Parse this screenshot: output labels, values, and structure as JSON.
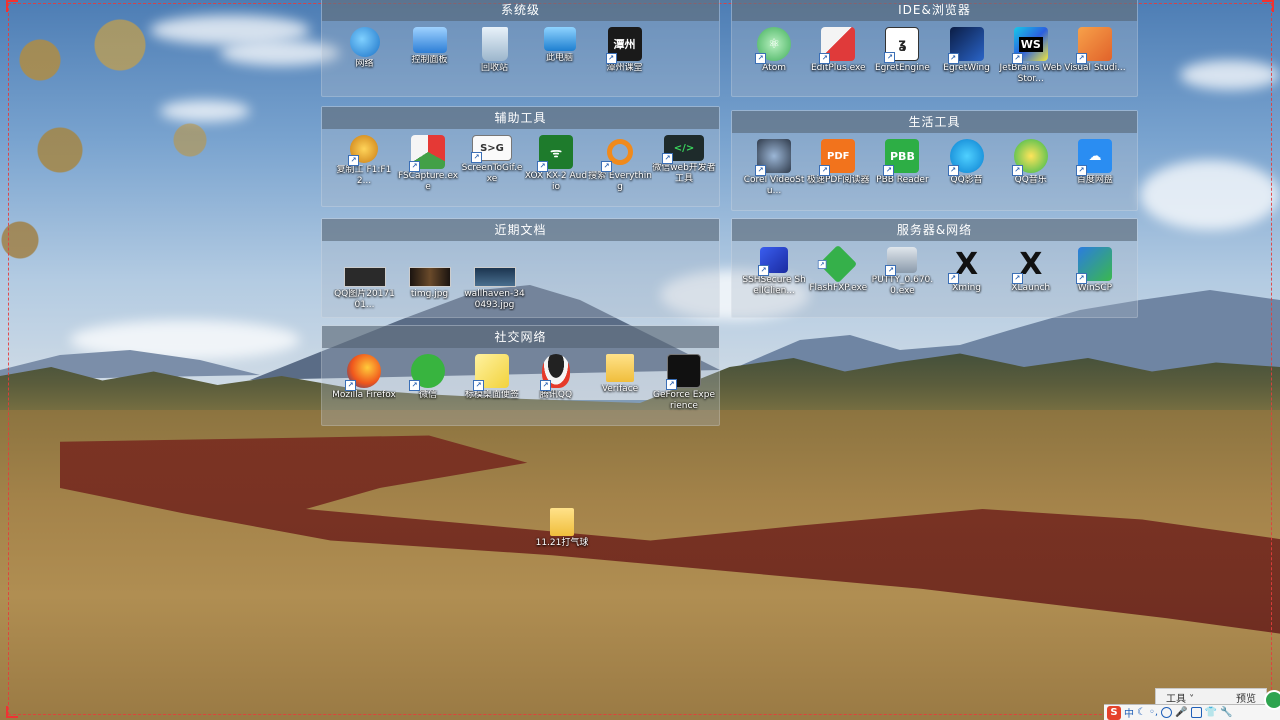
{
  "fences": [
    {
      "id": "system",
      "title": "系统级",
      "icons": [
        {
          "label": "网络",
          "icon": "network-icon",
          "shortcut": false
        },
        {
          "label": "控制面板",
          "icon": "control-panel-icon",
          "shortcut": false
        },
        {
          "label": "回收站",
          "icon": "recycle-bin-icon",
          "shortcut": false
        },
        {
          "label": "此电脑",
          "icon": "this-pc-icon",
          "shortcut": false
        },
        {
          "label": "潭州课堂",
          "icon": "tanzhou-classroom-icon",
          "shortcut": true,
          "glyph_text": "潭州"
        }
      ]
    },
    {
      "id": "ide",
      "title": "IDE&浏览器",
      "icons": [
        {
          "label": "Atom",
          "icon": "atom-icon",
          "shortcut": true
        },
        {
          "label": "EditPlus.exe",
          "icon": "editplus-icon",
          "shortcut": true
        },
        {
          "label": "EgretEngine",
          "icon": "egret-engine-icon",
          "shortcut": true
        },
        {
          "label": "EgretWing",
          "icon": "egret-wing-icon",
          "shortcut": true
        },
        {
          "label": "JetBrains WebStor...",
          "icon": "webstorm-icon",
          "shortcut": true,
          "glyph_text": "WS"
        },
        {
          "label": "Visual Studi...",
          "icon": "visual-studio-code-icon",
          "shortcut": true
        }
      ]
    },
    {
      "id": "aux",
      "title": "辅助工具",
      "icons": [
        {
          "label": "复制工 F1:F12...",
          "icon": "copy-tool-icon",
          "shortcut": true
        },
        {
          "label": "FSCapture.exe",
          "icon": "fscapture-icon",
          "shortcut": true
        },
        {
          "label": "ScreenToGif.exe",
          "icon": "screentogif-icon",
          "shortcut": true,
          "glyph_text": "S>G"
        },
        {
          "label": "XOX KX-2 Audio",
          "icon": "xox-audio-icon",
          "shortcut": true
        },
        {
          "label": "搜索 Everything",
          "icon": "everything-search-icon",
          "shortcut": true
        },
        {
          "label": "微信web开发者工具",
          "icon": "wechat-devtools-icon",
          "shortcut": true,
          "glyph_text": "</>"
        }
      ]
    },
    {
      "id": "life",
      "title": "生活工具",
      "icons": [
        {
          "label": "Corel VideoStu...",
          "icon": "corel-videostudio-icon",
          "shortcut": true
        },
        {
          "label": "极速PDF阅读器",
          "icon": "pdf-reader-icon",
          "shortcut": true,
          "glyph_text": "PDF"
        },
        {
          "label": "PBB Reader",
          "icon": "pbb-reader-icon",
          "shortcut": true,
          "glyph_text": "PBB"
        },
        {
          "label": "QQ影音",
          "icon": "qq-player-icon",
          "shortcut": true
        },
        {
          "label": "QQ音乐",
          "icon": "qq-music-icon",
          "shortcut": true
        },
        {
          "label": "百度网盘",
          "icon": "baidu-netdisk-icon",
          "shortcut": true
        }
      ]
    },
    {
      "id": "docs",
      "title": "近期文档",
      "icons": [
        {
          "label": "QQ图片2017101...",
          "icon": "image-thumbnail-icon",
          "thumb": "#2a2a2a"
        },
        {
          "label": "timg.jpg",
          "icon": "image-thumbnail-icon",
          "thumb": "#4a3a2a"
        },
        {
          "label": "wallhaven-340493.jpg",
          "icon": "image-thumbnail-icon",
          "thumb": "#2c4a66"
        }
      ]
    },
    {
      "id": "server",
      "title": "服务器&网络",
      "icons": [
        {
          "label": "SSHSecure ShellClien...",
          "icon": "ssh-secure-shell-icon",
          "shortcut": true
        },
        {
          "label": "FlashFXP.exe",
          "icon": "flashfxp-icon",
          "shortcut": true
        },
        {
          "label": "PUTTY_0.670.0.exe",
          "icon": "putty-icon",
          "shortcut": true
        },
        {
          "label": "Xming",
          "icon": "xming-icon",
          "shortcut": true,
          "glyph_text": "X"
        },
        {
          "label": "XLaunch",
          "icon": "xlaunch-icon",
          "shortcut": true,
          "glyph_text": "X"
        },
        {
          "label": "WinSCP",
          "icon": "winscp-icon",
          "shortcut": true
        }
      ]
    },
    {
      "id": "social",
      "title": "社交网络",
      "icons": [
        {
          "label": "Mozilla Firefox",
          "icon": "firefox-icon",
          "shortcut": true
        },
        {
          "label": "微信",
          "icon": "wechat-icon",
          "shortcut": true
        },
        {
          "label": "标模桌面便签",
          "icon": "sticky-notes-icon",
          "shortcut": true
        },
        {
          "label": "腾讯QQ",
          "icon": "tencent-qq-icon",
          "shortcut": true
        },
        {
          "label": "Veriface",
          "icon": "folder-icon",
          "shortcut": false
        },
        {
          "label": "GeForce Experience",
          "icon": "geforce-experience-icon",
          "shortcut": true
        }
      ]
    }
  ],
  "desktop_items": [
    {
      "label": "11.21打气球",
      "icon": "folder-icon"
    }
  ],
  "toolstrip": {
    "tools_label": "工具 ˅",
    "preview_label": "预览"
  },
  "ime": {
    "logo": "S",
    "mode": "中"
  },
  "colors": {
    "fence_bg": "rgba(170,185,200,0.32)",
    "fence_title_bg": "rgba(80,95,110,0.55)",
    "frame": "#e33333"
  }
}
